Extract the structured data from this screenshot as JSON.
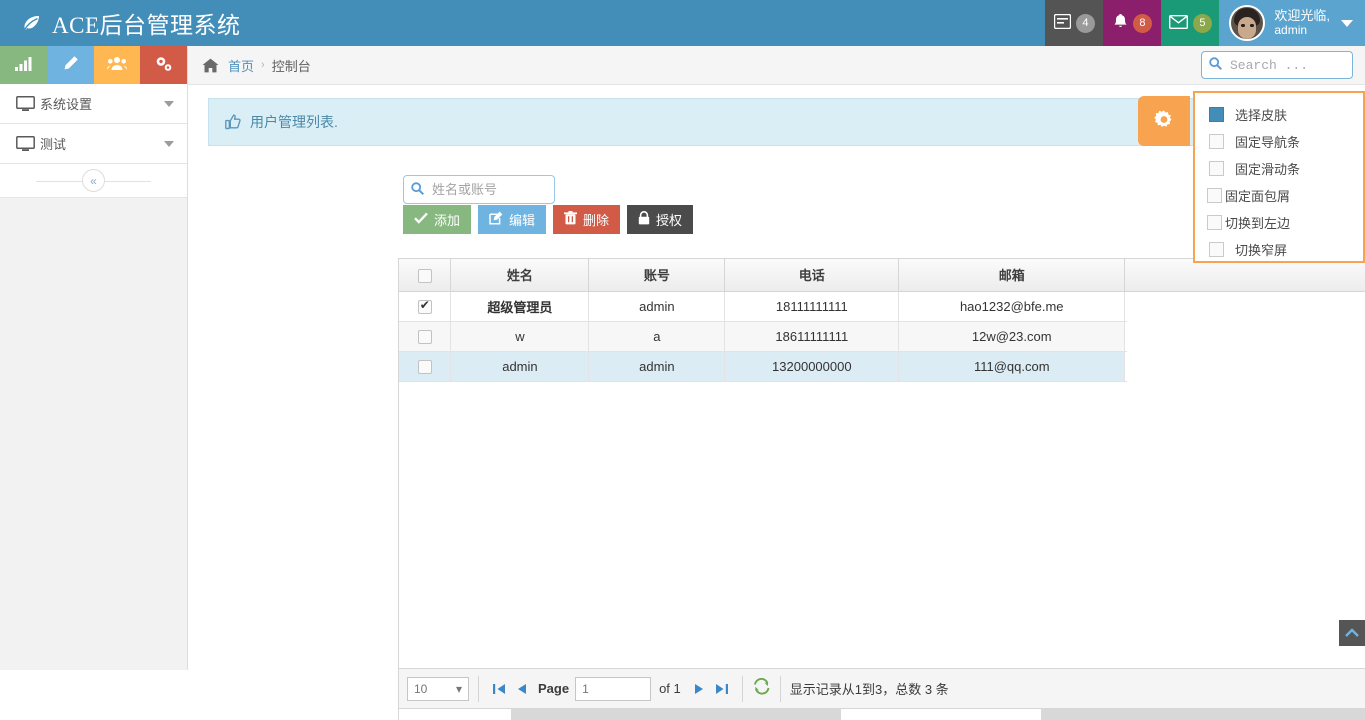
{
  "navbar": {
    "brand": "ACE后台管理系统",
    "brand_icon": "leaf-icon",
    "items": [
      {
        "icon": "tasks-icon",
        "badge": "4"
      },
      {
        "icon": "bell-icon",
        "badge": "8"
      },
      {
        "icon": "envelope-icon",
        "badge": "5"
      }
    ],
    "user": {
      "greeting": "欢迎光临,",
      "name": "admin"
    },
    "colors": {
      "navbar": "#438EB9",
      "tasks": "#555454",
      "bell": "#8B1F6B",
      "mail": "#1B9A77",
      "user": "#5BA4CF"
    }
  },
  "sidebar": {
    "shortcuts": [
      {
        "name": "chart-shortcut",
        "icon": "bar-chart-icon",
        "color": "#87B87F"
      },
      {
        "name": "edit-shortcut",
        "icon": "pencil-icon",
        "color": "#6FB3E0"
      },
      {
        "name": "users-shortcut",
        "icon": "users-icon",
        "color": "#FFB752"
      },
      {
        "name": "settings-shortcut",
        "icon": "cogs-icon",
        "color": "#D15B47"
      }
    ],
    "items": [
      {
        "label": "系统设置",
        "icon": "desktop-icon"
      },
      {
        "label": "测试",
        "icon": "desktop-icon"
      }
    ],
    "collapse_glyph": "«"
  },
  "breadcrumb": {
    "home_icon": "home-icon",
    "home": "首页",
    "separator": "›",
    "current": "控制台"
  },
  "nav_search": {
    "placeholder": "Search ...",
    "value": "",
    "icon": "search-icon"
  },
  "panel": {
    "icon": "thumbs-up-icon",
    "title": "用户管理列表.",
    "gear_icon": "gear-icon",
    "gear_color": "#F7A34F"
  },
  "settings_panel": {
    "rows": [
      {
        "label": "选择皮肤",
        "checked": true,
        "type": "skin"
      },
      {
        "label": "固定导航条",
        "checked": false,
        "type": "checkbox"
      },
      {
        "label": "固定滑动条",
        "checked": false,
        "type": "checkbox"
      },
      {
        "label": "固定面包屑",
        "checked": false,
        "type": "checkbox"
      },
      {
        "label": "切换到左边",
        "checked": false,
        "type": "checkbox"
      },
      {
        "label": "切换窄屏",
        "checked": false,
        "type": "checkbox"
      }
    ],
    "border_color": "#F7A34F"
  },
  "filter": {
    "placeholder": "姓名或账号",
    "value": "",
    "icon": "search-icon"
  },
  "buttons": [
    {
      "label": "添加",
      "icon": "check-icon",
      "color": "#87B87F"
    },
    {
      "label": "编辑",
      "icon": "edit-icon",
      "color": "#6FB3E0"
    },
    {
      "label": "删除",
      "icon": "trash-icon",
      "color": "#D15B47"
    },
    {
      "label": "授权",
      "icon": "lock-icon",
      "color": "#4B4B4B"
    }
  ],
  "table": {
    "columns": [
      "姓名",
      "账号",
      "电话",
      "邮箱"
    ],
    "rows": [
      {
        "checked": true,
        "selected": false,
        "bold": true,
        "name": "超级管理员",
        "account": "admin",
        "phone": "18111111111",
        "email": "hao1232@bfe.me"
      },
      {
        "checked": false,
        "selected": false,
        "bold": false,
        "name": "w",
        "account": "a",
        "phone": "18611111111",
        "email": "12w@23.com"
      },
      {
        "checked": false,
        "selected": true,
        "bold": false,
        "name": "admin",
        "account": "admin",
        "phone": "13200000000",
        "email": "111@qq.com"
      }
    ]
  },
  "pager": {
    "page_size": "10",
    "first_icon": "first-page-icon",
    "prev_icon": "prev-page-icon",
    "page_label": "Page",
    "page_value": "1",
    "of_label": "of 1",
    "next_icon": "next-page-icon",
    "last_icon": "last-page-icon",
    "refresh_icon": "refresh-icon",
    "info": "显示记录从1到3，总数 3 条"
  },
  "scroll_top": {
    "icon": "chevron-up-icon"
  }
}
